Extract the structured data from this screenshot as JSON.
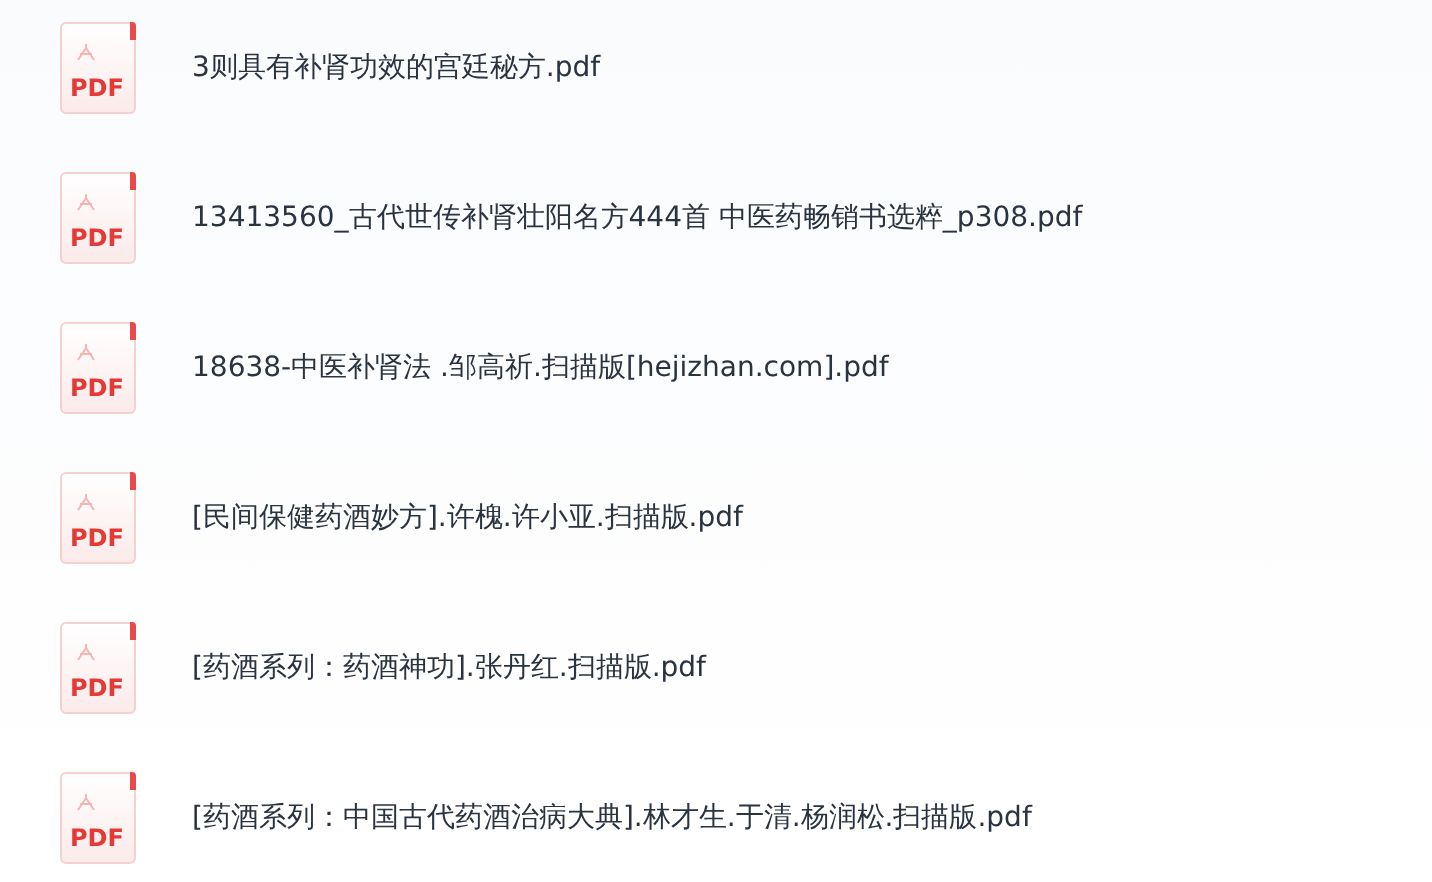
{
  "files": [
    {
      "icon_label": "PDF",
      "name": "3则具有补肾功效的宫廷秘方.pdf"
    },
    {
      "icon_label": "PDF",
      "name": "13413560_古代世传补肾壮阳名方444首  中医药畅销书选粹_p308.pdf"
    },
    {
      "icon_label": "PDF",
      "name": "18638-中医补肾法 .邹高祈.扫描版[hejizhan.com].pdf"
    },
    {
      "icon_label": "PDF",
      "name": "[民间保健药酒妙方].许槐.许小亚.扫描版.pdf"
    },
    {
      "icon_label": "PDF",
      "name": "[药酒系列：药酒神功].张丹红.扫描版.pdf"
    },
    {
      "icon_label": "PDF",
      "name": "[药酒系列：中国古代药酒治病大典].林才生.于清.杨润松.扫描版.pdf"
    }
  ]
}
